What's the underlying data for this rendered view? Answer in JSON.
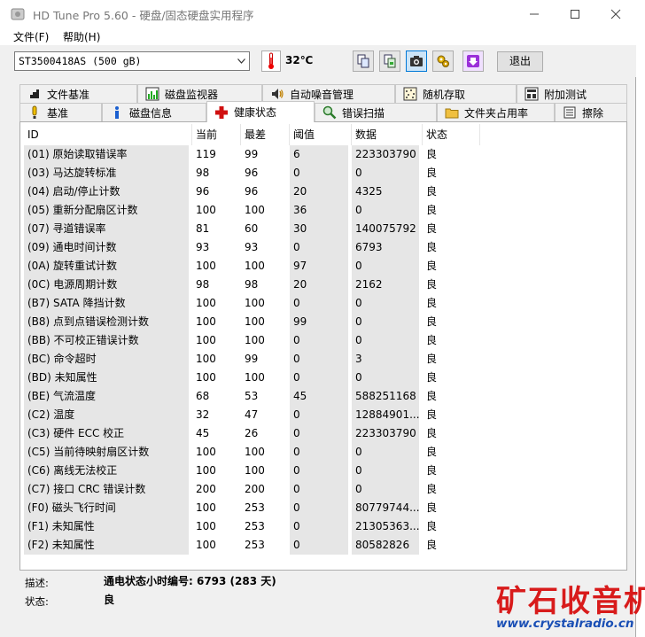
{
  "window": {
    "title": "HD Tune Pro 5.60 - 硬盘/固态硬盘实用程序"
  },
  "menu": {
    "file": "文件(F)",
    "help": "帮助(H)"
  },
  "toolbar": {
    "drive": "ST3500418AS (500 gB)",
    "temperature": "32℃",
    "exit_label": "退出"
  },
  "tabs_top": [
    {
      "label": "文件基准",
      "icon": "file-benchmark-icon"
    },
    {
      "label": "磁盘监视器",
      "icon": "disk-monitor-icon"
    },
    {
      "label": "自动噪音管理",
      "icon": "speaker-icon"
    },
    {
      "label": "随机存取",
      "icon": "random-access-icon"
    },
    {
      "label": "附加测试",
      "icon": "extra-tests-icon"
    }
  ],
  "tabs_bottom": [
    {
      "label": "基准",
      "icon": "benchmark-icon"
    },
    {
      "label": "磁盘信息",
      "icon": "info-icon"
    },
    {
      "label": "健康状态",
      "icon": "health-cross-icon",
      "selected": true
    },
    {
      "label": "错误扫描",
      "icon": "magnifier-icon"
    },
    {
      "label": "文件夹占用率",
      "icon": "folder-icon"
    },
    {
      "label": "擦除",
      "icon": "erase-icon"
    }
  ],
  "table": {
    "headers": [
      "ID",
      "当前",
      "最差",
      "阈值",
      "数据",
      "状态"
    ],
    "rows": [
      [
        "(01) 原始读取错误率",
        "119",
        "99",
        "6",
        "223303790",
        "良"
      ],
      [
        "(03) 马达旋转标准",
        "98",
        "96",
        "0",
        "0",
        "良"
      ],
      [
        "(04) 启动/停止计数",
        "96",
        "96",
        "20",
        "4325",
        "良"
      ],
      [
        "(05) 重新分配扇区计数",
        "100",
        "100",
        "36",
        "0",
        "良"
      ],
      [
        "(07) 寻道错误率",
        "81",
        "60",
        "30",
        "140075792",
        "良"
      ],
      [
        "(09) 通电时间计数",
        "93",
        "93",
        "0",
        "6793",
        "良"
      ],
      [
        "(0A) 旋转重试计数",
        "100",
        "100",
        "97",
        "0",
        "良"
      ],
      [
        "(0C) 电源周期计数",
        "98",
        "98",
        "20",
        "2162",
        "良"
      ],
      [
        "(B7) SATA 降挡计数",
        "100",
        "100",
        "0",
        "0",
        "良"
      ],
      [
        "(B8) 点到点错误检测计数",
        "100",
        "100",
        "99",
        "0",
        "良"
      ],
      [
        "(BB) 不可校正错误计数",
        "100",
        "100",
        "0",
        "0",
        "良"
      ],
      [
        "(BC) 命令超时",
        "100",
        "99",
        "0",
        "3",
        "良"
      ],
      [
        "(BD) 未知属性",
        "100",
        "100",
        "0",
        "0",
        "良"
      ],
      [
        "(BE) 气流温度",
        "68",
        "53",
        "45",
        "588251168",
        "良"
      ],
      [
        "(C2) 温度",
        "32",
        "47",
        "0",
        "12884901...",
        "良"
      ],
      [
        "(C3) 硬件 ECC 校正",
        "45",
        "26",
        "0",
        "223303790",
        "良"
      ],
      [
        "(C5) 当前待映射扇区计数",
        "100",
        "100",
        "0",
        "0",
        "良"
      ],
      [
        "(C6) 离线无法校正",
        "100",
        "100",
        "0",
        "0",
        "良"
      ],
      [
        "(C7) 接口 CRC 错误计数",
        "200",
        "200",
        "0",
        "0",
        "良"
      ],
      [
        "(F0) 磁头飞行时间",
        "100",
        "253",
        "0",
        "80779744...",
        "良"
      ],
      [
        "(F1) 未知属性",
        "100",
        "253",
        "0",
        "21305363...",
        "良"
      ],
      [
        "(F2) 未知属性",
        "100",
        "253",
        "0",
        "80582826",
        "良"
      ]
    ]
  },
  "description": {
    "desc_label": "描述:",
    "desc_value": "通电状态小时编号: 6793 (283 天)",
    "status_label": "状态:",
    "status_value": "良"
  },
  "watermark": {
    "text": "矿石收音机",
    "url": "www.crystalradio.cn"
  },
  "colors": {
    "shade": "#e6e6e6",
    "accent": "#0078d7",
    "watermark_red": "#d81b1b",
    "watermark_blue": "#1a4fb5"
  }
}
